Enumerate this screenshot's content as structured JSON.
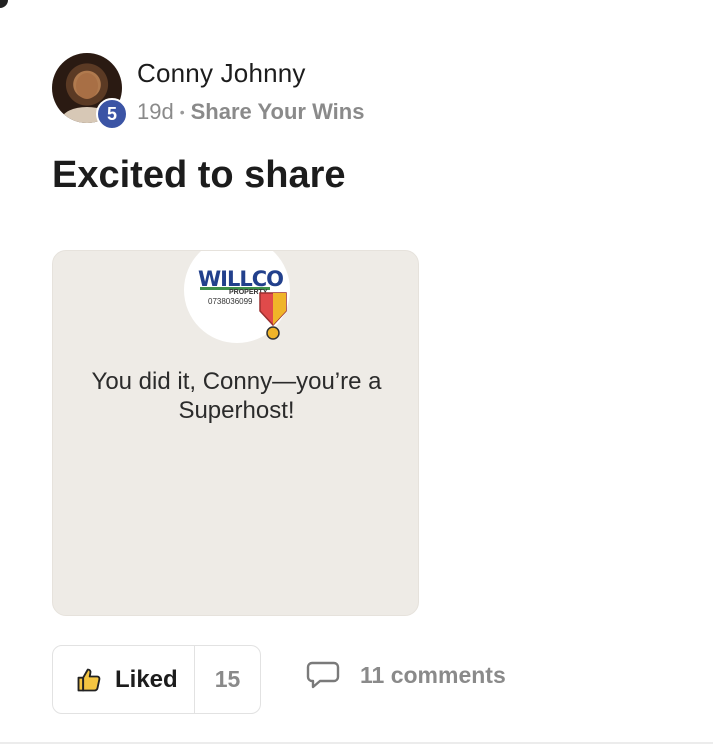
{
  "post": {
    "author": {
      "name": "Conny Johnny",
      "level": "5"
    },
    "age": "19d",
    "separator": "•",
    "category": "Share Your Wins",
    "title": "Excited to share",
    "image": {
      "logo_text": "WILLCO",
      "logo_sub": "PROPERTY",
      "logo_phone": "0738036099",
      "message": "You did it, Conny—you’re a Superhost!"
    },
    "actions": {
      "like_label": "Liked",
      "like_count": "15",
      "comments_label": "11 comments"
    }
  },
  "colors": {
    "level_badge": "#3b54a5",
    "image_bg": "#eeebe6",
    "logo_blue": "#22408c",
    "medal_red": "#e04a4a",
    "medal_gold": "#f0b429"
  }
}
